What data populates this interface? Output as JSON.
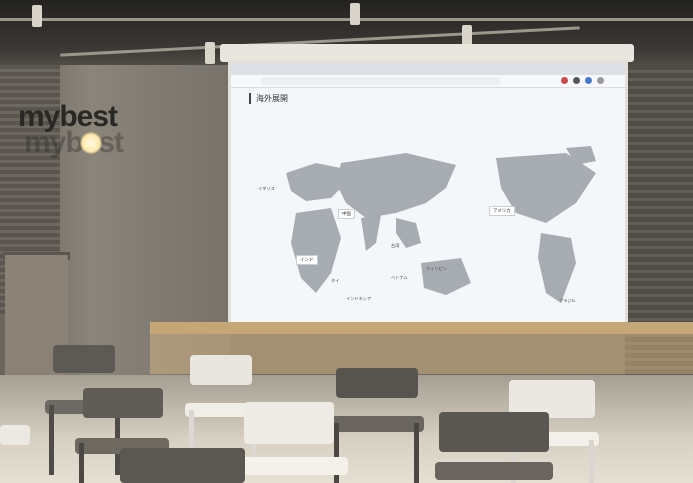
{
  "photo": {
    "logo_text": "mybest",
    "screen": {
      "page_heading": "海外展開",
      "page_subheading": "",
      "page_description": "",
      "map_labels": [
        {
          "id": "china",
          "label": "中国"
        },
        {
          "id": "usa",
          "label": "アメリカ"
        },
        {
          "id": "taiwan",
          "label": "台湾"
        },
        {
          "id": "india",
          "label": "インド"
        },
        {
          "id": "thailand",
          "label": "タイ"
        },
        {
          "id": "vietnam",
          "label": "ベトナム"
        },
        {
          "id": "philippines",
          "label": "フィリピン"
        },
        {
          "id": "indonesia",
          "label": "インドネシア"
        },
        {
          "id": "uk",
          "label": "イギリス"
        },
        {
          "id": "brazil",
          "label": "ブラジル"
        }
      ]
    }
  },
  "colors": {
    "screen_bg": "#f4f7fa",
    "map_land": "#a7acb3",
    "ledge": "#c4a677"
  },
  "icons": [
    "ceiling-light-icon",
    "pendant-bulb-icon"
  ]
}
